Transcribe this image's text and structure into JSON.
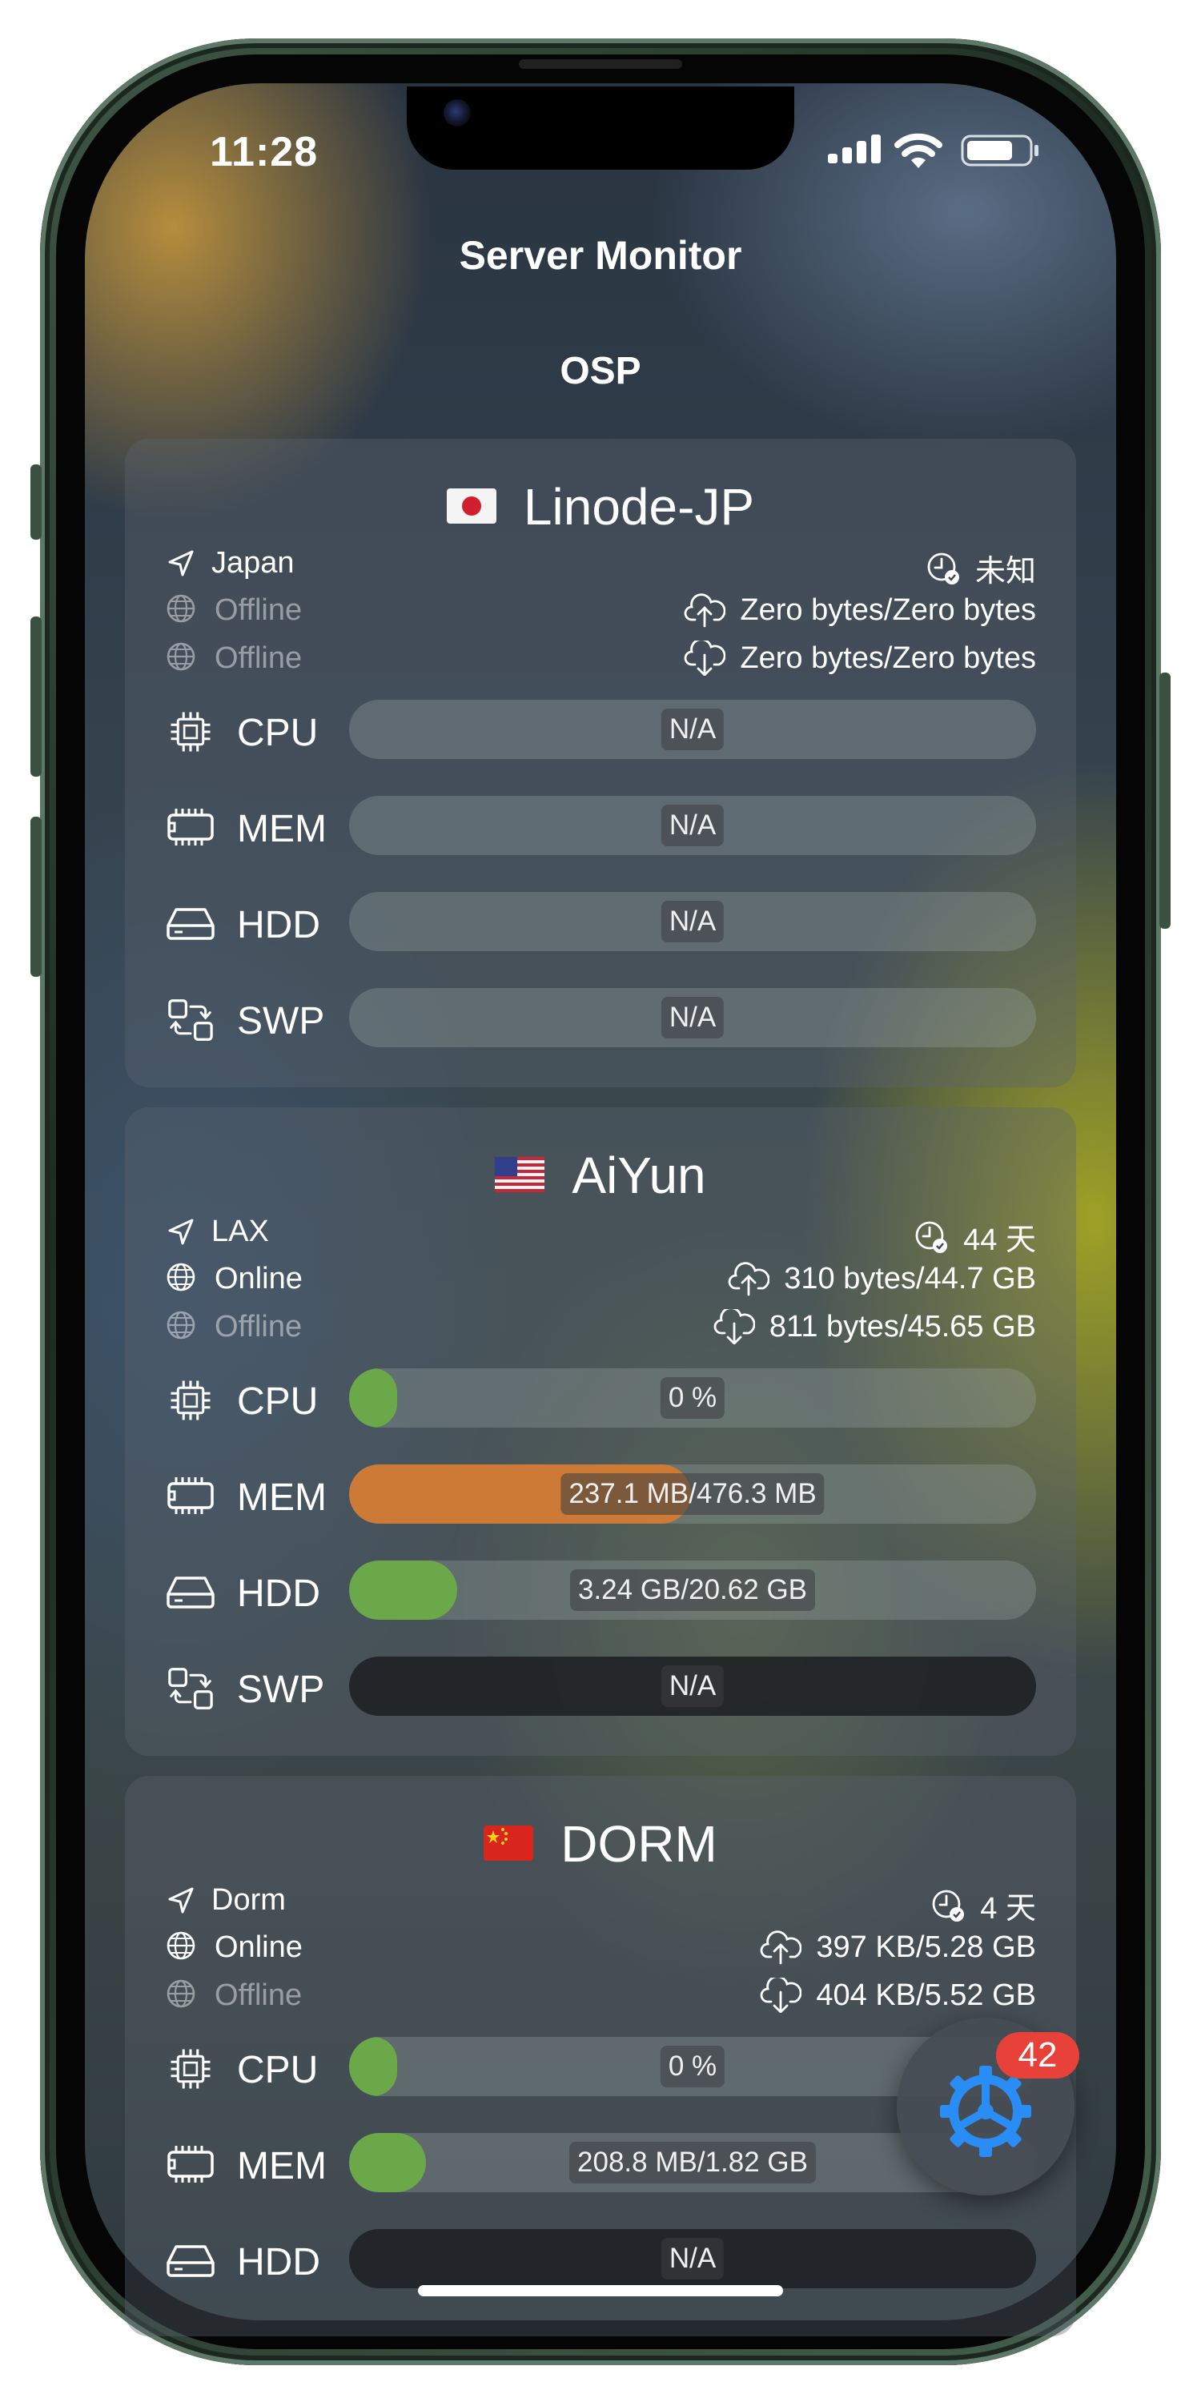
{
  "status_bar": {
    "time": "11:28"
  },
  "header": {
    "title": "Server Monitor",
    "group": "OSP"
  },
  "servers": [
    {
      "name": "Linode-JP",
      "flag": "japan-flag",
      "location": "Japan",
      "uptime": "未知",
      "ipv4": "Offline",
      "ipv6": "Offline",
      "traffic_up": "Zero bytes/Zero bytes",
      "traffic_down": "Zero bytes/Zero bytes",
      "meters": [
        {
          "label": "CPU",
          "text": "N/A",
          "fill": 0
        },
        {
          "label": "MEM",
          "text": "N/A",
          "fill": 0
        },
        {
          "label": "HDD",
          "text": "N/A",
          "fill": 0
        },
        {
          "label": "SWP",
          "text": "N/A",
          "fill": 0
        }
      ]
    },
    {
      "name": "AiYun",
      "flag": "usa-flag",
      "location": "LAX",
      "uptime": "44 天",
      "ipv4": "Online",
      "ipv6": "Offline",
      "traffic_up": "310 bytes/44.7 GB",
      "traffic_down": "811 bytes/45.65 GB",
      "meters": [
        {
          "label": "CPU",
          "text": "0 %",
          "fill": 0.07
        },
        {
          "label": "MEM",
          "text": "237.1 MB/476.3 MB",
          "fill": 0.4978
        },
        {
          "label": "HDD",
          "text": "3.24 GB/20.62 GB",
          "fill": 0.157
        },
        {
          "label": "SWP",
          "text": "N/A",
          "fill": 0
        }
      ]
    },
    {
      "name": "DORM",
      "flag": "china-flag",
      "location": "Dorm",
      "uptime": "4 天",
      "ipv4": "Online",
      "ipv6": "Offline",
      "traffic_up": "397 KB/5.28 GB",
      "traffic_down": "404 KB/5.52 GB",
      "meters": [
        {
          "label": "CPU",
          "text": "0 %",
          "fill": 0.07
        },
        {
          "label": "MEM",
          "text": "208.8 MB/1.82 GB",
          "fill": 0.112
        },
        {
          "label": "HDD",
          "text": "N/A",
          "fill": 0
        }
      ]
    }
  ],
  "fab": {
    "badge": "42",
    "icon": "gear-icon"
  },
  "colors": {
    "cpu_fill": "#6aa84a",
    "mem_fill": "#cc7a35",
    "hdd_fill": "#6aa84a",
    "badge": "#e8413a",
    "gear": "#2a8df5"
  }
}
